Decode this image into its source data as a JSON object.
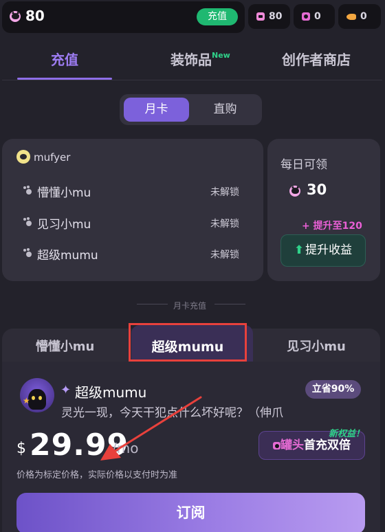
{
  "topbar": {
    "coin_amount": "80",
    "recharge_label": "充值",
    "resources": [
      {
        "icon": "lock-icon",
        "value": "80"
      },
      {
        "icon": "can-icon",
        "value": "0"
      },
      {
        "icon": "fish-icon",
        "value": "0"
      }
    ]
  },
  "tabs": {
    "recharge": "充值",
    "decorations": "装饰品",
    "new_tag": "New",
    "creator_store": "创作者商店"
  },
  "segment": {
    "monthly": "月卡",
    "direct": "直购"
  },
  "privileges": {
    "username": "mufyer",
    "rows": [
      {
        "label": "懵懂小mu",
        "status": "未解锁"
      },
      {
        "label": "见习小mu",
        "status": "未解锁"
      },
      {
        "label": "超级mumu",
        "status": "未解锁"
      }
    ]
  },
  "daily": {
    "title": "每日可领",
    "amount": "30",
    "upgrade_text": "+ 提升至120",
    "boost_label": "提升收益"
  },
  "section_label": "月卡充值",
  "tiers": {
    "tabs": [
      "懵懂小mu",
      "超级mumu",
      "见习小mu"
    ],
    "active_index": 1
  },
  "offer": {
    "title": "超级mumu",
    "save_badge": "立省90%",
    "description": "灵光一现，今天干犯点什么坏好呢？（伸爪",
    "currency": "$",
    "price": "29.99",
    "unit": "/mo",
    "note": "价格为标定价格，实际价格以支付时为准",
    "new_benefit": "新权益！",
    "double_can": "罐头",
    "double_text": "首充双倍",
    "subscribe": "订阅"
  },
  "colors": {
    "accent": "#7c61db",
    "green": "#1fb871",
    "pink": "#ea5fd6",
    "annotation": "#e8413c"
  }
}
